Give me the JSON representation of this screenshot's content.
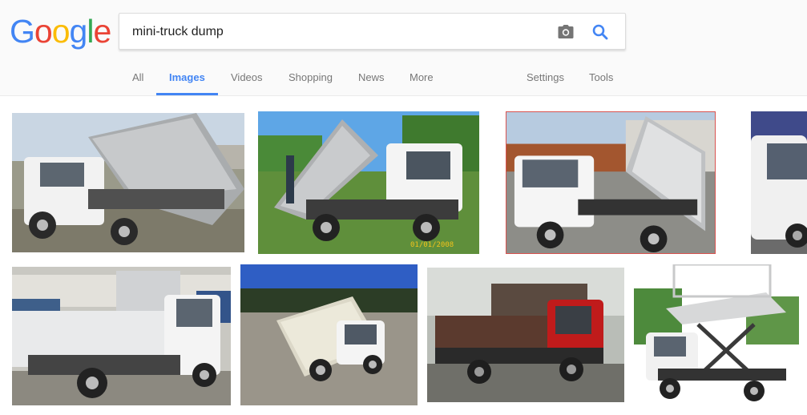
{
  "logo": {
    "letters": [
      "G",
      "o",
      "o",
      "g",
      "l",
      "e"
    ],
    "colors": [
      "#4285f4",
      "#ea4335",
      "#fbbc05",
      "#4285f4",
      "#34a853",
      "#ea4335"
    ]
  },
  "search": {
    "query": "mini-truck dump"
  },
  "icons": {
    "camera": "camera-icon",
    "search": "search-icon"
  },
  "tabs": {
    "all": "All",
    "images": "Images",
    "videos": "Videos",
    "shopping": "Shopping",
    "news": "News",
    "more": "More",
    "settings": "Settings",
    "tools": "Tools"
  },
  "colors": {
    "accent": "#4285f4",
    "tab_text": "#777777",
    "header_bg": "#fafafa"
  },
  "results": {
    "date_stamp": "01/01/2008"
  }
}
